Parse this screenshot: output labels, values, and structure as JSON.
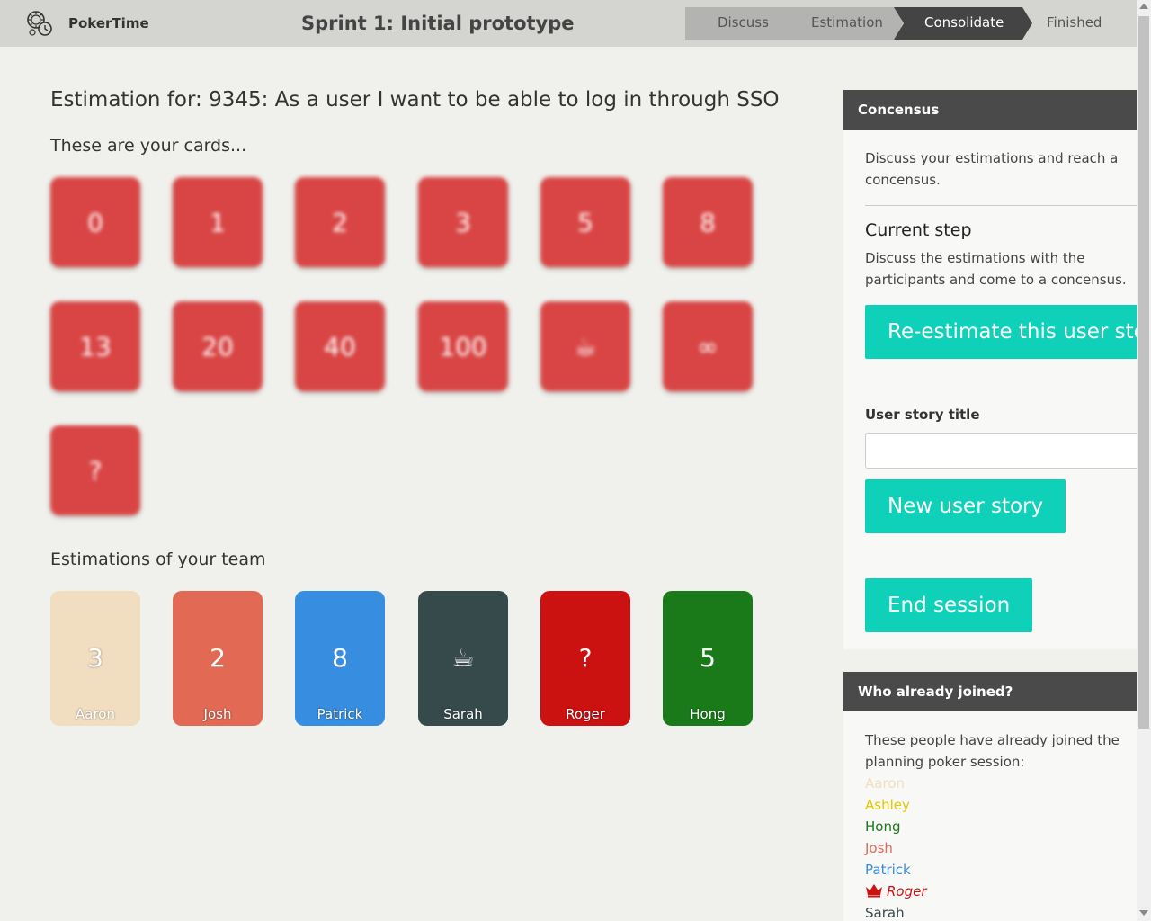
{
  "app": {
    "name": "PokerTime",
    "logo_icon": "poker-chip-clock-icon"
  },
  "sprint_title": "Sprint 1: Initial prototype",
  "steps": [
    {
      "label": "Discuss",
      "state": "done"
    },
    {
      "label": "Estimation",
      "state": "done"
    },
    {
      "label": "Consolidate",
      "state": "active"
    },
    {
      "label": "Finished",
      "state": "pending"
    }
  ],
  "heading": "Estimation for: 9345: As a user I want to be able to log in through SSO",
  "cards_heading": "These are your cards...",
  "cards": [
    "0",
    "1",
    "2",
    "3",
    "5",
    "8",
    "13",
    "20",
    "40",
    "100",
    "☕",
    "∞",
    "?"
  ],
  "team_heading": "Estimations of your team",
  "team": [
    {
      "name": "Aaron",
      "value": "3",
      "color": "#f1ddc0"
    },
    {
      "name": "Josh",
      "value": "2",
      "color": "#e26a55"
    },
    {
      "name": "Patrick",
      "value": "8",
      "color": "#378ee0"
    },
    {
      "name": "Sarah",
      "value": "☕",
      "color": "#364a4c"
    },
    {
      "name": "Roger",
      "value": "?",
      "color": "#cc1111"
    },
    {
      "name": "Hong",
      "value": "5",
      "color": "#1a7a1a"
    }
  ],
  "consensus_panel": {
    "title": "Concensus",
    "intro": "Discuss your estimations and reach a concensus.",
    "current_step_title": "Current step",
    "current_step_text": "Discuss the estimations with the participants and come to a concensus.",
    "reestimate_button": "Re-estimate this user story",
    "user_story_label": "User story title",
    "user_story_value": "",
    "new_story_button": "New user story",
    "end_session_button": "End session"
  },
  "joined_panel": {
    "title": "Who already joined?",
    "intro": "These people have already joined the planning poker session:",
    "people": [
      {
        "name": "Aaron",
        "color": "#f1ddc0",
        "host": false
      },
      {
        "name": "Ashley",
        "color": "#e6c800",
        "host": false
      },
      {
        "name": "Hong",
        "color": "#1a7a1a",
        "host": false
      },
      {
        "name": "Josh",
        "color": "#e26a55",
        "host": false
      },
      {
        "name": "Patrick",
        "color": "#378ee0",
        "host": false
      },
      {
        "name": "Roger",
        "color": "#cc1111",
        "host": true
      },
      {
        "name": "Sarah",
        "color": "#364a4c",
        "host": false
      }
    ]
  },
  "colors": {
    "accent": "#0fd0b8",
    "card_red": "#d94545",
    "header_dark": "#4a4a4a"
  }
}
